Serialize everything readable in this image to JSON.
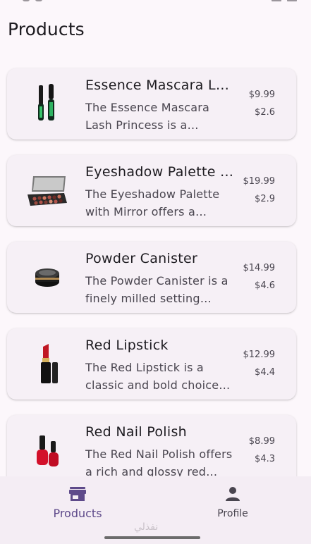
{
  "page": {
    "title": "Products"
  },
  "products": [
    {
      "name": "Essence Mascara Lash Princess",
      "description": "The Essence Mascara Lash Princess is a popular mascara known for its volumizing and lengthening effects.",
      "price": "$9.99",
      "discount": "$2.6",
      "thumb_icon": "mascara-icon"
    },
    {
      "name": "Eyeshadow Palette with Mirror",
      "description": "The Eyeshadow Palette with Mirror offers a versatile range of eyeshadow shades.",
      "price": "$19.99",
      "discount": "$2.9",
      "thumb_icon": "eyeshadow-palette-icon"
    },
    {
      "name": "Powder Canister",
      "description": "The Powder Canister is a finely milled setting powder.",
      "price": "$14.99",
      "discount": "$4.6",
      "thumb_icon": "powder-canister-icon"
    },
    {
      "name": "Red Lipstick",
      "description": "The Red Lipstick is a classic and bold choice for adding a pop of color.",
      "price": "$12.99",
      "discount": "$4.4",
      "thumb_icon": "lipstick-icon"
    },
    {
      "name": "Red Nail Polish",
      "description": "The Red Nail Polish offers a rich and glossy red hue.",
      "price": "$8.99",
      "discount": "$4.3",
      "thumb_icon": "nail-polish-icon"
    }
  ],
  "bottom_nav": {
    "products_label": "Products",
    "profile_label": "Profile",
    "active": "products"
  },
  "colors": {
    "accent": "#5e4a8a",
    "background": "#fcf7fb",
    "card": "#f6f0f6",
    "nav_background": "#f4edf4"
  },
  "watermark": "نفذلي"
}
